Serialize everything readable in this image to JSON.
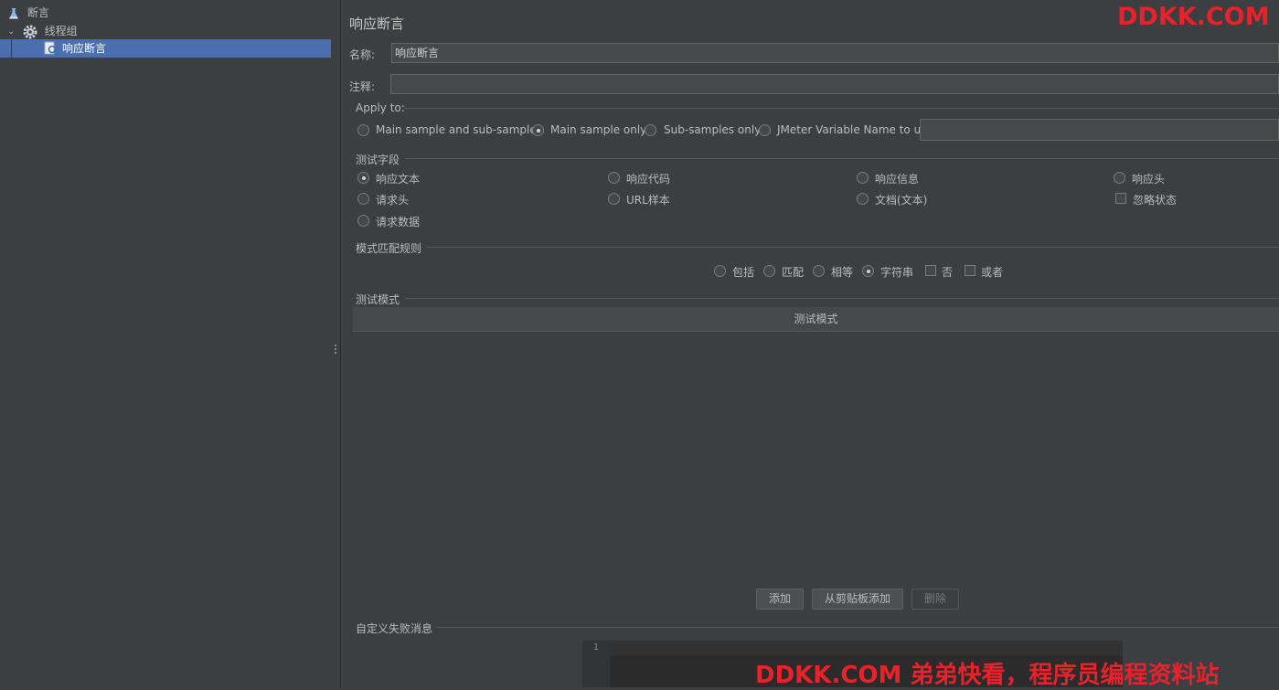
{
  "tree": {
    "items": [
      {
        "label": "断言",
        "icon": "flask-icon"
      },
      {
        "label": "线程组",
        "icon": "gear-icon"
      },
      {
        "label": "响应断言",
        "icon": "magnifier-icon"
      }
    ]
  },
  "panel": {
    "title": "响应断言",
    "name_label": "名称:",
    "name_value": "响应断言",
    "comment_label": "注释:",
    "comment_value": "",
    "apply_to": {
      "label": "Apply to:",
      "options": [
        "Main sample and sub-samples",
        "Main sample only",
        "Sub-samples only",
        "JMeter Variable Name to use"
      ],
      "selected": "Main sample only",
      "variable_value": ""
    },
    "test_field": {
      "label": "测试字段",
      "options": [
        "响应文本",
        "响应代码",
        "响应信息",
        "响应头",
        "请求头",
        "URL样本",
        "文档(文本)",
        "请求数据"
      ],
      "selected": "响应文本",
      "ignore_status_label": "忽略状态"
    },
    "pattern_rules": {
      "label": "模式匹配规则",
      "options": [
        "包括",
        "匹配",
        "相等",
        "字符串"
      ],
      "selected": "字符串",
      "checks": [
        "否",
        "或者"
      ]
    },
    "test_patterns": {
      "label": "测试模式",
      "column": "测试模式"
    },
    "buttons": {
      "add": "添加",
      "add_clipboard": "从剪贴板添加",
      "delete": "删除"
    },
    "custom_fail": {
      "label": "自定义失败消息",
      "line_number": "1"
    }
  },
  "watermark": {
    "top": "DDKK.COM",
    "bottom": "DDKK.COM 弟弟快看，程序员编程资料站"
  },
  "colors": {
    "selection": "#4b6eaf",
    "background": "#3c3f41",
    "watermark": "#e8222b"
  }
}
